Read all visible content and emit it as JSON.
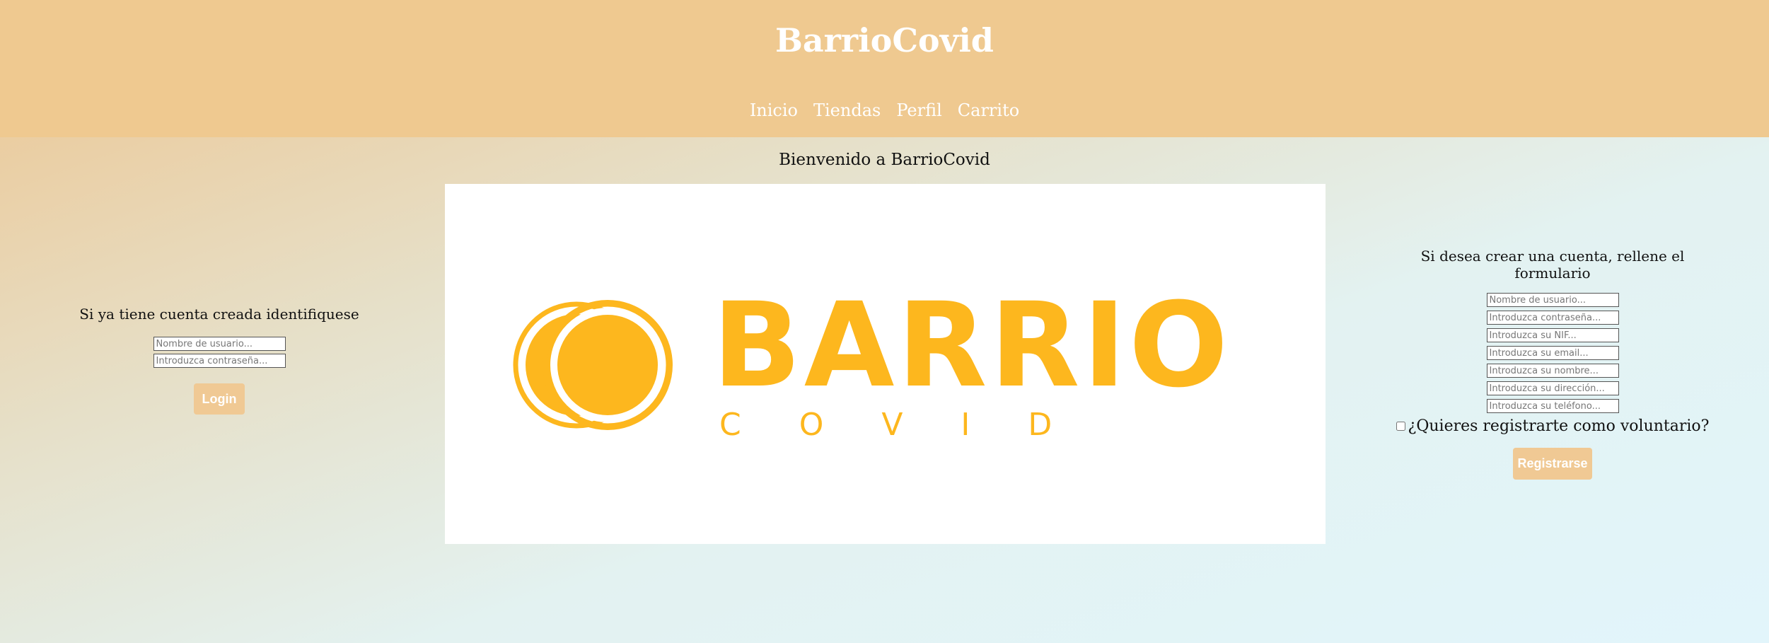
{
  "header": {
    "site_title": "BarrioCovid",
    "nav": [
      "Inicio",
      "Tiendas",
      "Perfil",
      "Carrito"
    ]
  },
  "main": {
    "welcome": "Bienvenido a BarrioCovid",
    "logo": {
      "word": "BARRIO",
      "sub": "C O V I D",
      "color": "#fdb71e"
    }
  },
  "login": {
    "heading": "Si ya tiene cuenta creada identifiquese",
    "username_placeholder": "Nombre de usuario...",
    "password_placeholder": "Introduzca contraseña...",
    "button": "Login"
  },
  "register": {
    "heading": "Si desea crear una cuenta, rellene el formulario",
    "fields": [
      "Nombre de usuario...",
      "Introduzca contraseña...",
      "Introduzca su NIF...",
      "Introduzca su email...",
      "Introduzca su nombre...",
      "Introduzca su dirección...",
      "Introduzca su teléfono..."
    ],
    "volunteer_label": "¿Quieres registrarte como voluntario?",
    "button": "Registrarse"
  },
  "colors": {
    "header_bg": "#efc990",
    "button_bg": "#f0c994",
    "logo_yellow": "#fdb71e"
  }
}
